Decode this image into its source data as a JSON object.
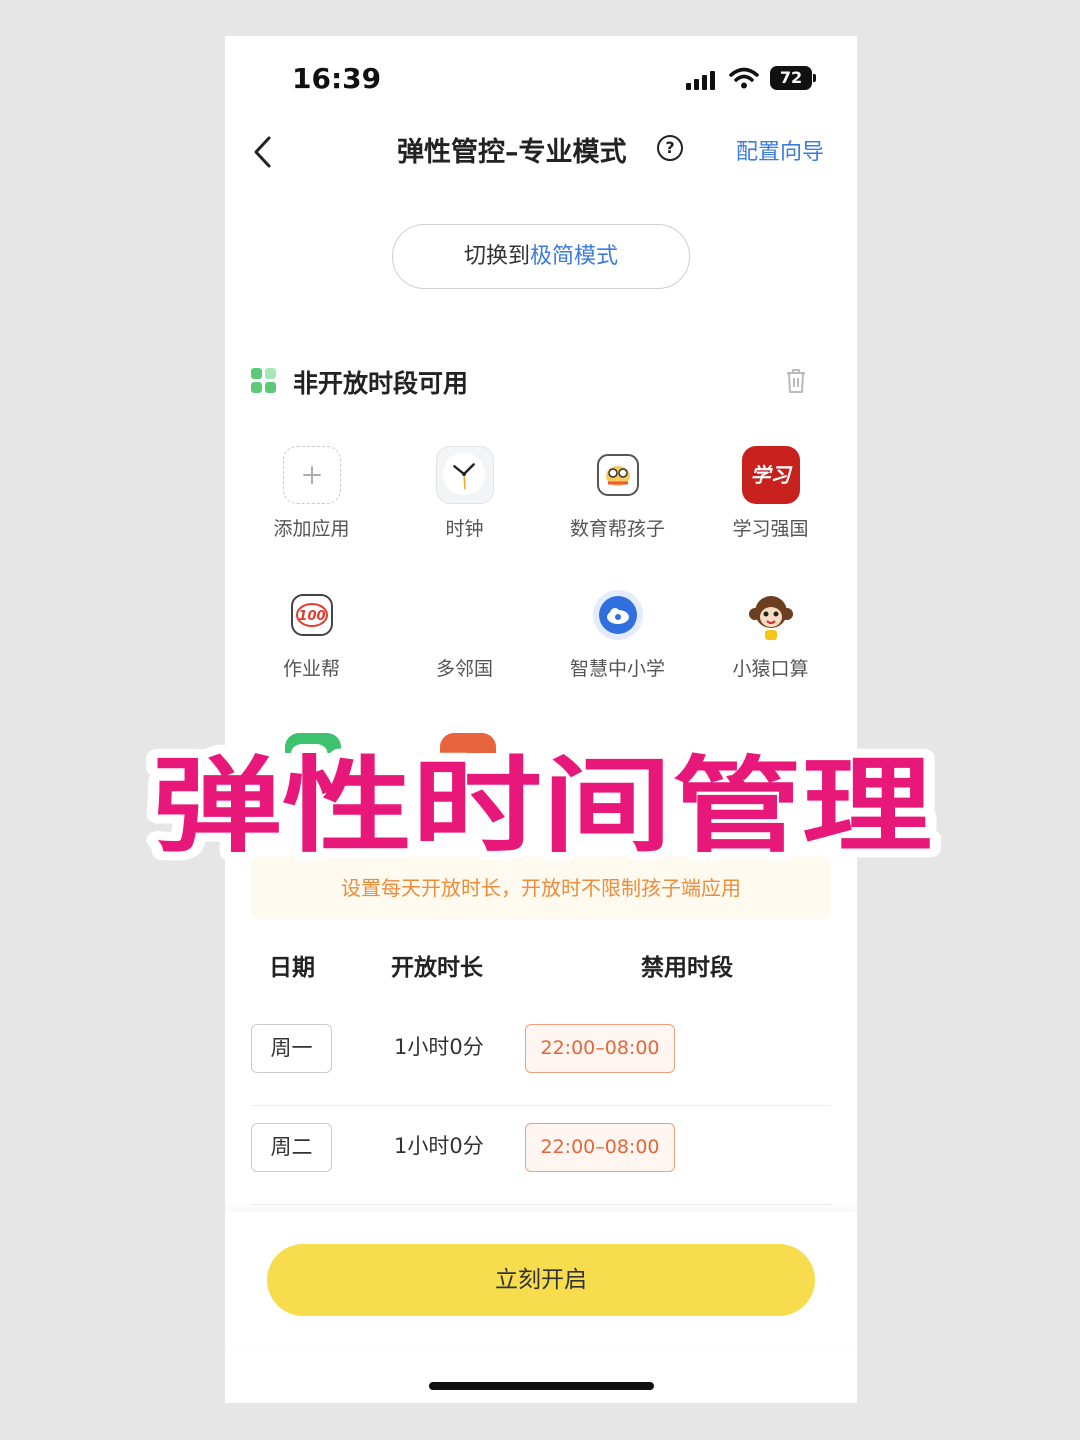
{
  "status_bar": {
    "time": "16:39",
    "battery": "72"
  },
  "header": {
    "title": "弹性管控–专业模式",
    "help_glyph": "?",
    "guide_link": "配置向导"
  },
  "mode_switch": {
    "prefix": "切换到",
    "highlight": "极简模式"
  },
  "section": {
    "title": "非开放时段可用"
  },
  "apps": [
    {
      "label": "添加应用",
      "icon": "add-icon"
    },
    {
      "label": "时钟",
      "icon": "clock-icon"
    },
    {
      "label": "数育帮孩子",
      "icon": "owl-icon"
    },
    {
      "label": "学习强国",
      "icon": "xuexi-icon",
      "icon_text": "学习"
    },
    {
      "label": "作业帮",
      "icon": "zuoyebang-icon",
      "icon_text": "100"
    },
    {
      "label": "多邻国",
      "icon": "duolingo-icon"
    },
    {
      "label": "智慧中小学",
      "icon": "cloud-icon"
    },
    {
      "label": "小猿口算",
      "icon": "monkey-icon"
    }
  ],
  "overlay_banner": {
    "text": "弹性时间管理",
    "color": "#e8177a"
  },
  "notice": {
    "text": "设置每天开放时长，开放时不限制孩子端应用"
  },
  "schedule": {
    "headers": {
      "date": "日期",
      "duration": "开放时长",
      "banned": "禁用时段"
    },
    "rows": [
      {
        "day": "周一",
        "duration": "1小时0分",
        "banned": "22:00–08:00"
      },
      {
        "day": "周二",
        "duration": "1小时0分",
        "banned": "22:00–08:00"
      }
    ]
  },
  "cta": {
    "label": "立刻开启"
  },
  "colors": {
    "accent_blue": "#3d7be0",
    "cta_yellow": "#f7dd4d",
    "notice_orange": "#ee8c3a",
    "ban_orange": "#e2673a"
  }
}
